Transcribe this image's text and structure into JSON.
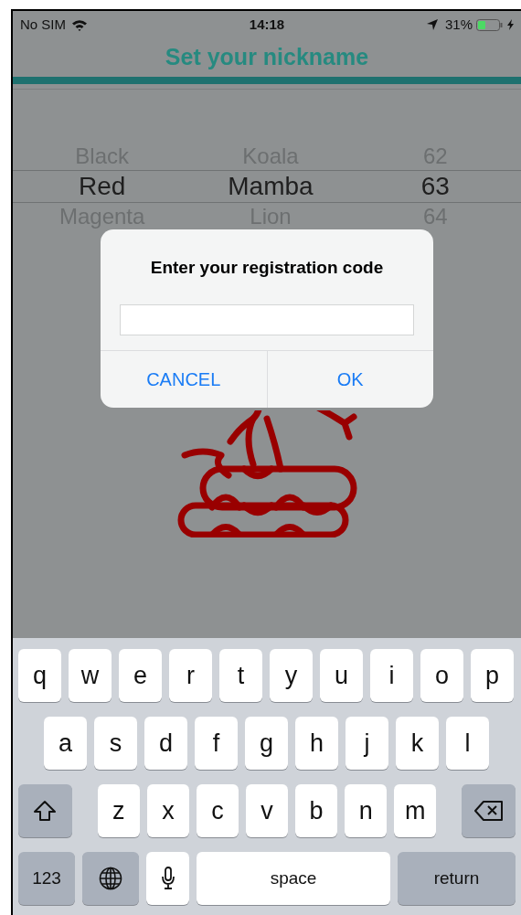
{
  "status_bar": {
    "carrier": "No SIM",
    "time": "14:18",
    "battery": "31%"
  },
  "title": "Set your nickname",
  "picker": {
    "columns": [
      {
        "items": [
          {
            "label": "Black",
            "selected": false
          },
          {
            "label": "Red",
            "selected": true
          },
          {
            "label": "Magenta",
            "selected": false
          }
        ]
      },
      {
        "items": [
          {
            "label": "Koala",
            "selected": false
          },
          {
            "label": "Mamba",
            "selected": true
          },
          {
            "label": "Lion",
            "selected": false
          }
        ]
      },
      {
        "items": [
          {
            "label": "62",
            "selected": false
          },
          {
            "label": "63",
            "selected": true
          },
          {
            "label": "64",
            "selected": false
          }
        ]
      }
    ]
  },
  "dialog": {
    "title": "Enter your registration code",
    "buttons": [
      "CANCEL",
      "OK"
    ]
  },
  "keyboard": {
    "rows": [
      {
        "keys": [
          {
            "kind": "letter",
            "label": "q"
          },
          {
            "kind": "letter",
            "label": "w"
          },
          {
            "kind": "letter",
            "label": "e"
          },
          {
            "kind": "letter",
            "label": "r"
          },
          {
            "kind": "letter",
            "label": "t"
          },
          {
            "kind": "letter",
            "label": "y"
          },
          {
            "kind": "letter",
            "label": "u"
          },
          {
            "kind": "letter",
            "label": "i"
          },
          {
            "kind": "letter",
            "label": "o"
          },
          {
            "kind": "letter",
            "label": "p"
          }
        ]
      },
      {
        "keys": [
          {
            "kind": "letter",
            "label": "a"
          },
          {
            "kind": "letter",
            "label": "s"
          },
          {
            "kind": "letter",
            "label": "d"
          },
          {
            "kind": "letter",
            "label": "f"
          },
          {
            "kind": "letter",
            "label": "g"
          },
          {
            "kind": "letter",
            "label": "h"
          },
          {
            "kind": "letter",
            "label": "j"
          },
          {
            "kind": "letter",
            "label": "k"
          },
          {
            "kind": "letter",
            "label": "l"
          }
        ]
      },
      {
        "keys": [
          {
            "kind": "shift"
          },
          {
            "kind": "letter",
            "label": "z"
          },
          {
            "kind": "letter",
            "label": "x"
          },
          {
            "kind": "letter",
            "label": "c"
          },
          {
            "kind": "letter",
            "label": "v"
          },
          {
            "kind": "letter",
            "label": "b"
          },
          {
            "kind": "letter",
            "label": "n"
          },
          {
            "kind": "letter",
            "label": "m"
          },
          {
            "kind": "delete"
          }
        ]
      },
      {
        "keys": [
          {
            "kind": "function",
            "label": "123"
          },
          {
            "kind": "globe"
          },
          {
            "kind": "mic"
          },
          {
            "kind": "space",
            "label": "space"
          },
          {
            "kind": "return",
            "label": "return"
          }
        ]
      }
    ]
  }
}
